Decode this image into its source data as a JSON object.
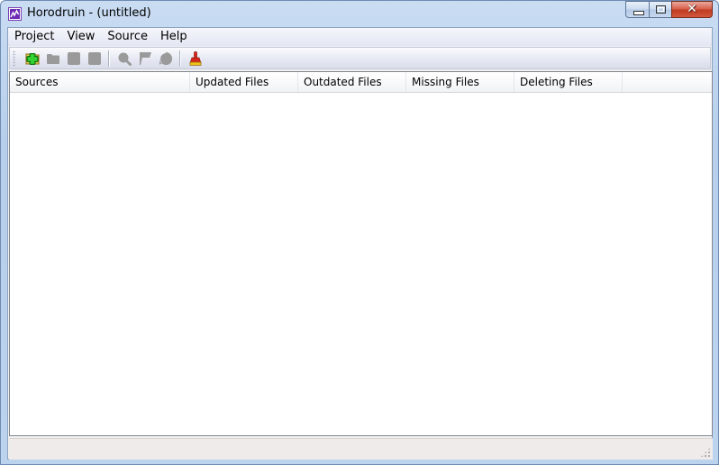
{
  "window": {
    "title": "Horodruin - (untitled)",
    "app_icon": "horodruin-logo-icon",
    "caption_buttons": [
      {
        "name": "minimize",
        "icon": "minimize-icon"
      },
      {
        "name": "maximize",
        "icon": "maximize-icon"
      },
      {
        "name": "close",
        "icon": "close-icon",
        "glyph": "✕"
      }
    ]
  },
  "menubar": {
    "items": [
      {
        "label": "Project"
      },
      {
        "label": "View"
      },
      {
        "label": "Source"
      },
      {
        "label": "Help"
      }
    ]
  },
  "toolbar": {
    "buttons": [
      {
        "name": "add-source",
        "icon": "add-folder-icon",
        "enabled": true
      },
      {
        "name": "open-folder",
        "icon": "folder-icon",
        "enabled": false
      },
      {
        "name": "edit-source",
        "icon": "document-icon",
        "enabled": false
      },
      {
        "name": "remove-source",
        "icon": "document-icon",
        "enabled": false
      },
      {
        "name": "scan",
        "icon": "magnifier-icon",
        "enabled": false
      },
      {
        "name": "sync",
        "icon": "flag-icon",
        "enabled": false
      },
      {
        "name": "refresh",
        "icon": "refresh-icon",
        "enabled": false
      },
      {
        "name": "clean",
        "icon": "broom-icon",
        "enabled": true
      }
    ]
  },
  "listview": {
    "columns": [
      {
        "label": "Sources"
      },
      {
        "label": "Updated Files"
      },
      {
        "label": "Outdated Files"
      },
      {
        "label": "Missing Files"
      },
      {
        "label": "Deleting Files"
      },
      {
        "label": ""
      }
    ],
    "rows": []
  },
  "statusbar": {
    "text": ""
  },
  "colors": {
    "title_bg": "#c9dcf2",
    "close_button": "#c8462c",
    "disabled_icon": "#9a9a9a",
    "add_icon_green": "#1fb31f",
    "broom_red": "#d8261c",
    "broom_yellow": "#f2c21a"
  }
}
